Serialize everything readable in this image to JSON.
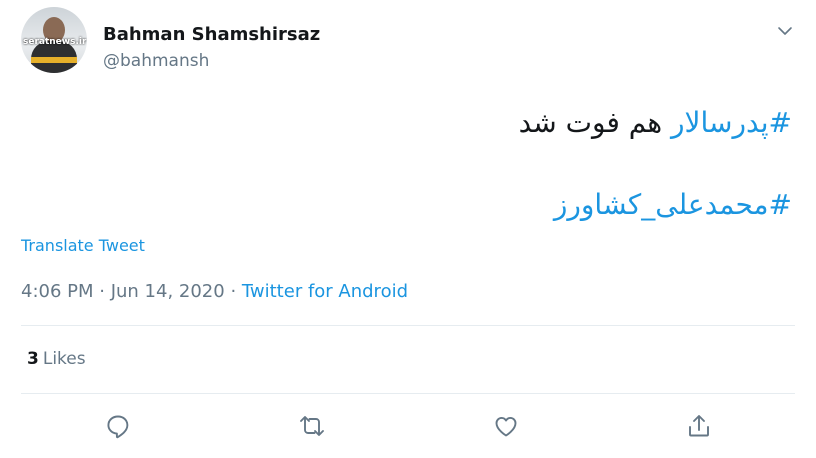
{
  "author": {
    "display_name": "Bahman Shamshirsaz",
    "handle": "@bahmansh",
    "avatar_watermark": "seratnews.ir"
  },
  "tweet": {
    "line1_hashtag": "#پدرسالار",
    "line1_text": " هم فوت شد",
    "line2_hashtag": "#محمدعلی_کشاورز"
  },
  "translate_label": "Translate Tweet",
  "meta": {
    "time": "4:06 PM",
    "separator": " · ",
    "date": "Jun 14, 2020",
    "source": "Twitter for Android"
  },
  "stats": {
    "likes_count": "3",
    "likes_label": "Likes"
  },
  "actions": {
    "reply_icon": "reply-icon",
    "retweet_icon": "retweet-icon",
    "like_icon": "heart-icon",
    "share_icon": "share-icon"
  },
  "colors": {
    "link": "#1b95e0",
    "secondary_text": "#657786",
    "divider": "#e6ecf0"
  }
}
